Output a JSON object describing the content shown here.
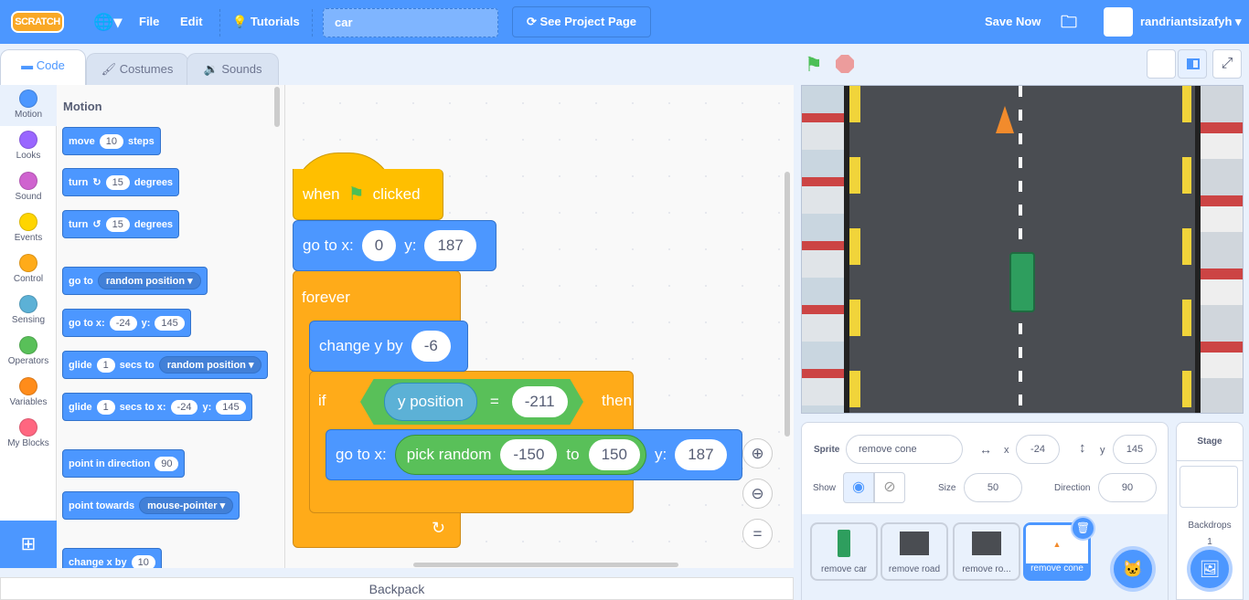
{
  "menu": {
    "logo": "SCRATCH",
    "file": "File",
    "edit": "Edit",
    "tutorials": "Tutorials",
    "project_title": "car",
    "see_project": "See Project Page",
    "save_now": "Save Now",
    "username": "randriantsizafyh"
  },
  "tabs": [
    {
      "label": "Code"
    },
    {
      "label": "Costumes"
    },
    {
      "label": "Sounds"
    }
  ],
  "categories": [
    {
      "label": "Motion",
      "color": "#4c97ff"
    },
    {
      "label": "Looks",
      "color": "#9966ff"
    },
    {
      "label": "Sound",
      "color": "#cf63cf"
    },
    {
      "label": "Events",
      "color": "#ffd500"
    },
    {
      "label": "Control",
      "color": "#ffab19"
    },
    {
      "label": "Sensing",
      "color": "#5cb1d6"
    },
    {
      "label": "Operators",
      "color": "#59c059"
    },
    {
      "label": "Variables",
      "color": "#ff8c1a"
    },
    {
      "label": "My Blocks",
      "color": "#ff6680"
    }
  ],
  "palette": {
    "heading": "Motion",
    "blocks": {
      "move": {
        "a": "move",
        "v": "10",
        "b": "steps"
      },
      "turn_r": {
        "a": "turn",
        "v": "15",
        "b": "degrees"
      },
      "turn_l": {
        "a": "turn",
        "v": "15",
        "b": "degrees"
      },
      "goto": {
        "a": "go to",
        "dd": "random position"
      },
      "gotoxy": {
        "a": "go to x:",
        "x": "-24",
        "b": "y:",
        "y": "145"
      },
      "glide": {
        "a": "glide",
        "v": "1",
        "b": "secs to",
        "dd": "random position"
      },
      "glidexy": {
        "a": "glide",
        "v": "1",
        "b": "secs to x:",
        "x": "-24",
        "c": "y:",
        "y": "145"
      },
      "point": {
        "a": "point in direction",
        "v": "90"
      },
      "towards": {
        "a": "point towards",
        "dd": "mouse-pointer"
      },
      "changex": {
        "a": "change x by",
        "v": "10"
      }
    }
  },
  "script": {
    "hat": {
      "a": "when",
      "b": "clicked"
    },
    "goto": {
      "a": "go to x:",
      "x": "0",
      "b": "y:",
      "y": "187"
    },
    "forever": "forever",
    "changey": {
      "a": "change y by",
      "v": "-6"
    },
    "if": {
      "a": "if",
      "reporter": "y position",
      "op": "=",
      "v": "-211",
      "b": "then"
    },
    "goto2": {
      "a": "go to x:",
      "rand": "pick random",
      "from": "-150",
      "to_label": "to",
      "to": "150",
      "b": "y:",
      "y": "187"
    }
  },
  "backpack": "Backpack",
  "sprite_info": {
    "sprite_label": "Sprite",
    "sprite_name": "remove cone",
    "x_label": "x",
    "x": "-24",
    "y_label": "y",
    "y": "145",
    "show_label": "Show",
    "size_label": "Size",
    "size": "50",
    "direction_label": "Direction",
    "direction": "90"
  },
  "sprites": [
    {
      "name": "remove car"
    },
    {
      "name": "remove road"
    },
    {
      "name": "remove ro..."
    },
    {
      "name": "remove cone",
      "selected": true
    }
  ],
  "stage_panel": {
    "title": "Stage",
    "backdrops_label": "Backdrops",
    "backdrops_count": "1"
  },
  "colors": {
    "accent": "#4c97ff",
    "motion": "#4c97ff",
    "control": "#ffab19",
    "events": "#ffbf00",
    "operators": "#59c059"
  }
}
